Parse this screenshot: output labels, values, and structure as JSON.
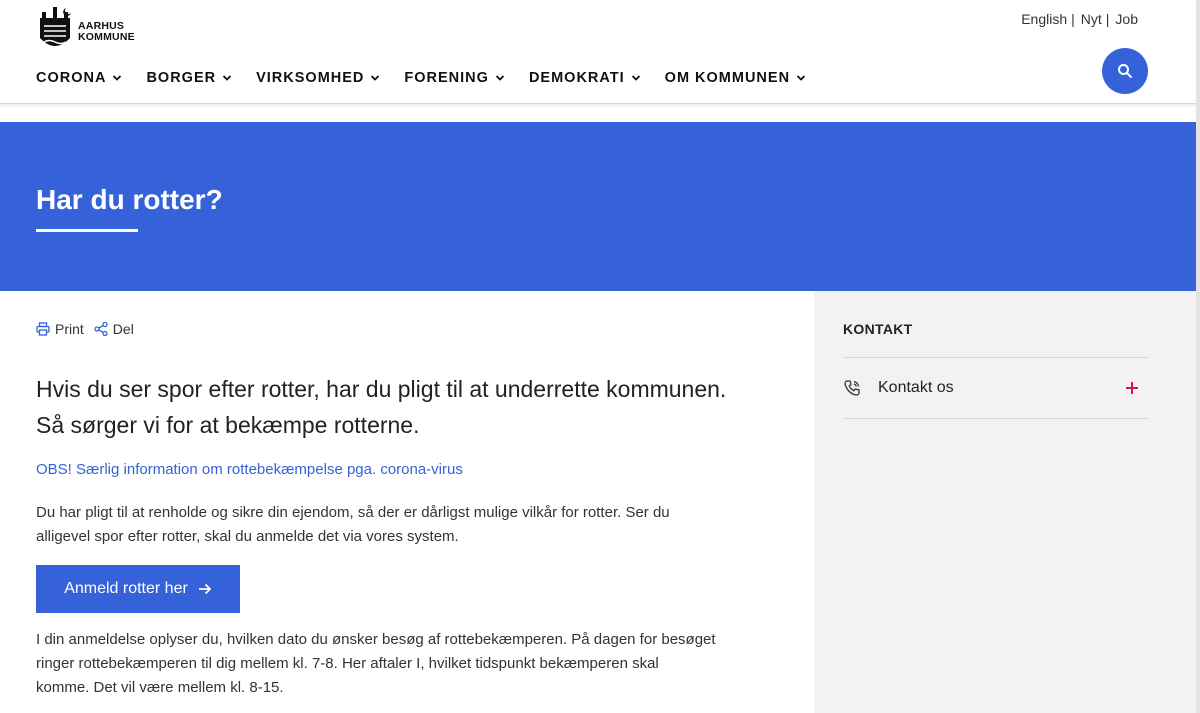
{
  "header": {
    "logo_line1": "AARHUS",
    "logo_line2": "KOMMUNE",
    "utility_links": [
      "English",
      "Nyt",
      "Job"
    ],
    "utility_separator": "|",
    "nav": [
      "CORONA",
      "BORGER",
      "VIRKSOMHED",
      "FORENING",
      "DEMOKRATI",
      "OM KOMMUNEN"
    ],
    "search_icon": "search-icon"
  },
  "hero": {
    "title": "Har du rotter?"
  },
  "main": {
    "tools": {
      "print": "Print",
      "share": "Del"
    },
    "lead": "Hvis du ser spor efter rotter, har du pligt til at underrette kommunen. Så sørger vi for at bekæmpe rotterne.",
    "notice_link": "OBS! Særlig information om rottebekæmpelse pga. corona-virus",
    "paragraph1": "Du har pligt til at renholde og sikre din ejendom, så der er dårligst mulige vilkår for rotter. Ser du alligevel spor efter rotter, skal du anmelde det via vores system.",
    "cta_label": "Anmeld rotter her",
    "paragraph2": "I din anmeldelse oplyser du, hvilken dato du ønsker besøg af rottebekæmperen. På dagen for besøget ringer rottebekæmperen til dig mellem kl. 7-8. Her aftaler I, hvilket tidspunkt bekæmperen skal komme. Det vil være mellem kl. 8-15."
  },
  "sidebar": {
    "heading": "KONTAKT",
    "contact_label": "Kontakt os"
  },
  "colors": {
    "brand_blue": "#3562d8",
    "accent_pink": "#d8115c",
    "sidebar_bg": "#f2f2f2"
  }
}
